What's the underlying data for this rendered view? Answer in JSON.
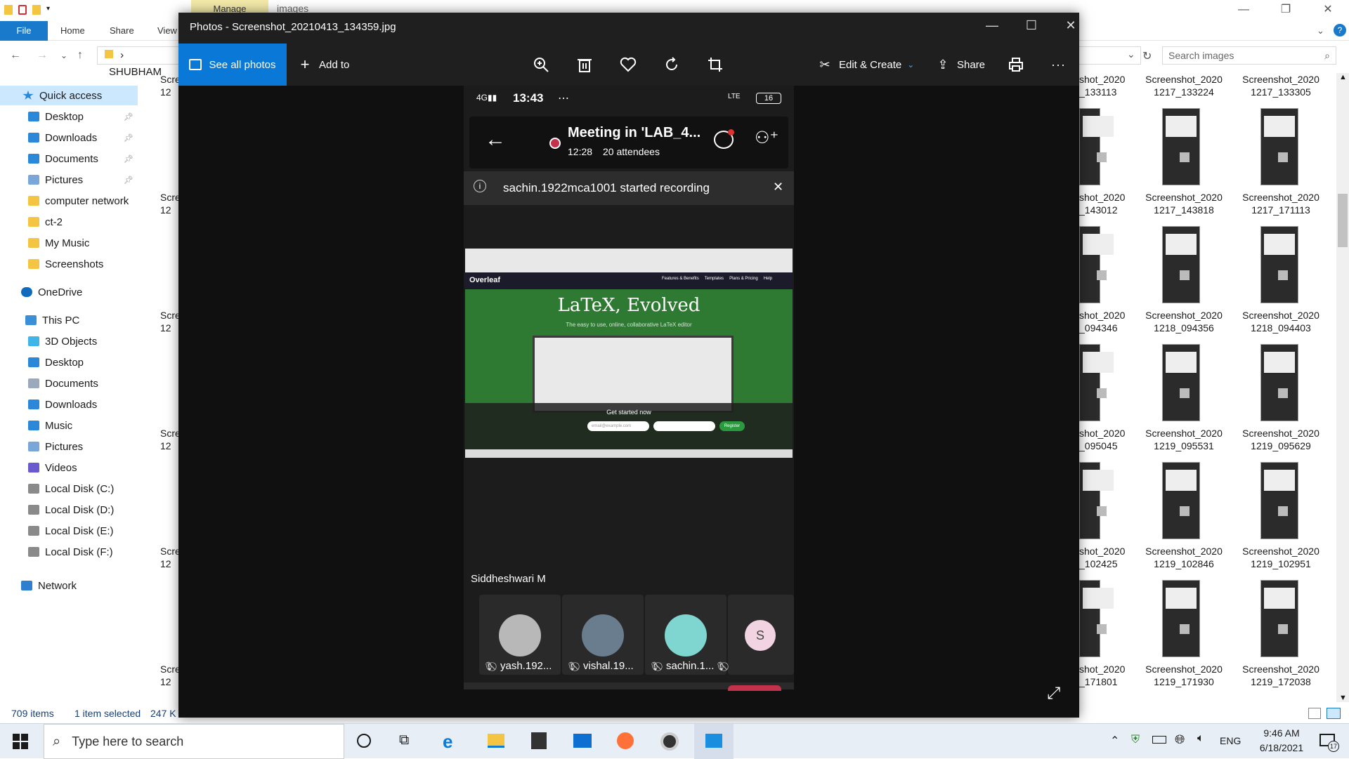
{
  "explorer": {
    "manage_tab": "Manage",
    "window_title": "images",
    "ribbon": {
      "file": "File",
      "home": "Home",
      "share": "Share",
      "view": "View"
    },
    "address_fragment": "SHUBHAM",
    "search_placeholder": "Search images",
    "nav": {
      "quick_access": "Quick access",
      "quick_items": [
        "Desktop",
        "Downloads",
        "Documents",
        "Pictures",
        "computer network",
        "ct-2",
        "My Music",
        "Screenshots"
      ],
      "onedrive": "OneDrive",
      "this_pc": "This PC",
      "pc_items": [
        "3D Objects",
        "Desktop",
        "Documents",
        "Downloads",
        "Music",
        "Pictures",
        "Videos",
        "Local Disk (C:)",
        "Local Disk (D:)",
        "Local Disk (E:)",
        "Local Disk (F:)"
      ],
      "network": "Network"
    },
    "left_col_labels": [
      [
        "Scre",
        "12"
      ],
      [
        "Scre",
        "12"
      ],
      [
        "Scre",
        "12"
      ],
      [
        "Scre",
        "12"
      ],
      [
        "Scre",
        "12"
      ],
      [
        "Scre",
        "12"
      ]
    ],
    "files_partial": [
      [
        "shot_2020",
        "_133113"
      ],
      [
        "shot_2020",
        "_143012"
      ],
      [
        "shot_2020",
        "_094346"
      ],
      [
        "shot_2020",
        "_095045"
      ],
      [
        "shot_2020",
        "_102425"
      ],
      [
        "shot_2020",
        "_171801"
      ]
    ],
    "files_col2": [
      [
        "Screenshot_2020",
        "1217_133224"
      ],
      [
        "Screenshot_2020",
        "1217_143818"
      ],
      [
        "Screenshot_2020",
        "1218_094356"
      ],
      [
        "Screenshot_2020",
        "1219_095531"
      ],
      [
        "Screenshot_2020",
        "1219_102846"
      ],
      [
        "Screenshot_2020",
        "1219_171930"
      ]
    ],
    "files_col3": [
      [
        "Screenshot_2020",
        "1217_133305"
      ],
      [
        "Screenshot_2020",
        "1217_171113"
      ],
      [
        "Screenshot_2020",
        "1218_094403"
      ],
      [
        "Screenshot_2020",
        "1219_095629"
      ],
      [
        "Screenshot_2020",
        "1219_102951"
      ],
      [
        "Screenshot_2020",
        "1219_172038"
      ]
    ],
    "status": {
      "items": "709 items",
      "selected": "1 item selected",
      "size": "247 K"
    }
  },
  "photos": {
    "title": "Photos - Screenshot_20210413_134359.jpg",
    "see_all": "See all photos",
    "add_to": "Add to",
    "edit_create": "Edit & Create",
    "share": "Share",
    "more": "···"
  },
  "phone": {
    "signal": "4G",
    "time": "13:43",
    "battery": "16",
    "meeting_title": "Meeting in 'LAB_4...",
    "meeting_time": "12:28",
    "attendees": "20 attendees",
    "banner": "sachin.1922mca1001 started recording",
    "shared": {
      "brand": "Overleaf",
      "menu": [
        "Features & Benefits",
        "Templates",
        "Plans & Pricing",
        "Help"
      ],
      "headline": "LaTeX, Evolved",
      "subline": "The easy to use, online, collaborative LaTeX editor",
      "get_started": "Get started now",
      "email_placeholder": "email@example.com",
      "register": "Register"
    },
    "speaker": "Siddheshwari M",
    "tiles": [
      {
        "label": "yash.192...",
        "color": "#b8b8b8"
      },
      {
        "label": "vishal.19...",
        "color": "#6a7d8e"
      },
      {
        "label": "sachin.1...",
        "color": "#7fd6d0"
      },
      {
        "label": "S",
        "color": "#f2d3e1"
      }
    ]
  },
  "taskbar": {
    "search_placeholder": "Type here to search",
    "lang": "ENG",
    "time": "9:46 AM",
    "date": "6/18/2021",
    "notif_count": "17"
  }
}
